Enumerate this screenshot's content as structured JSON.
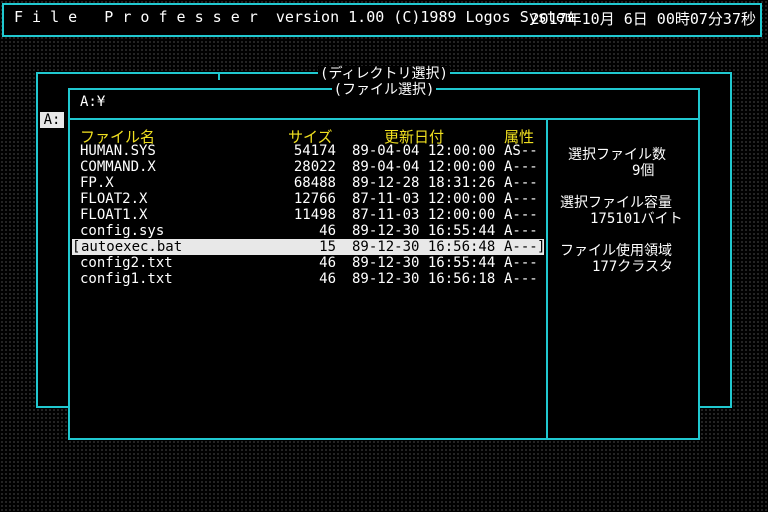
{
  "titlebar": {
    "title": "F i l e   P r o f e s s e r  version 1.00 (C)1989 Logos System",
    "clock": "2017年10月 6日 00時07分37秒"
  },
  "dir_window": {
    "title": "(ディレクトリ選択)",
    "drive": "A:"
  },
  "file_window": {
    "title": "(ファイル選択)",
    "path": "A:¥",
    "headers": {
      "name": "ファイル名",
      "size": "サイズ",
      "date": "更新日付",
      "attr": "属性"
    },
    "files": [
      {
        "name": "HUMAN.SYS",
        "size": "54174",
        "date": "89-04-04 12:00:00",
        "attr": "AS--"
      },
      {
        "name": "COMMAND.X",
        "size": "28022",
        "date": "89-04-04 12:00:00",
        "attr": "A---"
      },
      {
        "name": "FP.X",
        "size": "68488",
        "date": "89-12-28 18:31:26",
        "attr": "A---"
      },
      {
        "name": "FLOAT2.X",
        "size": "12766",
        "date": "87-11-03 12:00:00",
        "attr": "A---"
      },
      {
        "name": "FLOAT1.X",
        "size": "11498",
        "date": "87-11-03 12:00:00",
        "attr": "A---"
      },
      {
        "name": "config.sys",
        "size": "46",
        "date": "89-12-30 16:55:44",
        "attr": "A---"
      },
      {
        "name": "autoexec.bat",
        "size": "15",
        "date": "89-12-30 16:56:48",
        "attr": "A---"
      },
      {
        "name": "config2.txt",
        "size": "46",
        "date": "89-12-30 16:55:44",
        "attr": "A---"
      },
      {
        "name": "config1.txt",
        "size": "46",
        "date": "89-12-30 16:56:18",
        "attr": "A---"
      }
    ],
    "selected_open_bracket": "[",
    "selected_close_bracket": "]"
  },
  "info_panel": {
    "selected_count_label": "選択ファイル数",
    "selected_count_value": "9個",
    "selected_size_label": "選択ファイル容量",
    "selected_size_value": "175101バイト",
    "disk_usage_label": "ファイル使用領域",
    "disk_usage_value": "177クラスタ"
  },
  "colors": {
    "frame": "#20c8d0",
    "header": "#f0e020",
    "selection": "#e8e8e8"
  }
}
